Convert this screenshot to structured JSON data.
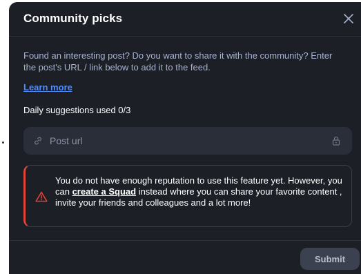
{
  "modal": {
    "title": "Community picks",
    "description": "Found an interesting post? Do you want to share it with the community? Enter the post's URL / link below to add it to the feed.",
    "learn_more": "Learn more",
    "daily_suggestions": "Daily suggestions used 0/3"
  },
  "url_input": {
    "placeholder": "Post url",
    "value": "",
    "icon": "link-icon",
    "trailing_icon": "lock-icon"
  },
  "alert": {
    "icon": "warning-triangle-icon",
    "text_before": "You do not have enough reputation to use this feature yet. However, you can ",
    "link_text": "create a Squad",
    "text_after": " instead where you can share your favorite content , invite your friends and colleagues and a lot more!",
    "accent_color": "#e04337"
  },
  "footer": {
    "submit_label": "Submit"
  },
  "colors": {
    "background": "#1c1f26",
    "link": "#4e8cff",
    "input_bg": "#2a2e38",
    "submit_bg": "#3c4150"
  }
}
